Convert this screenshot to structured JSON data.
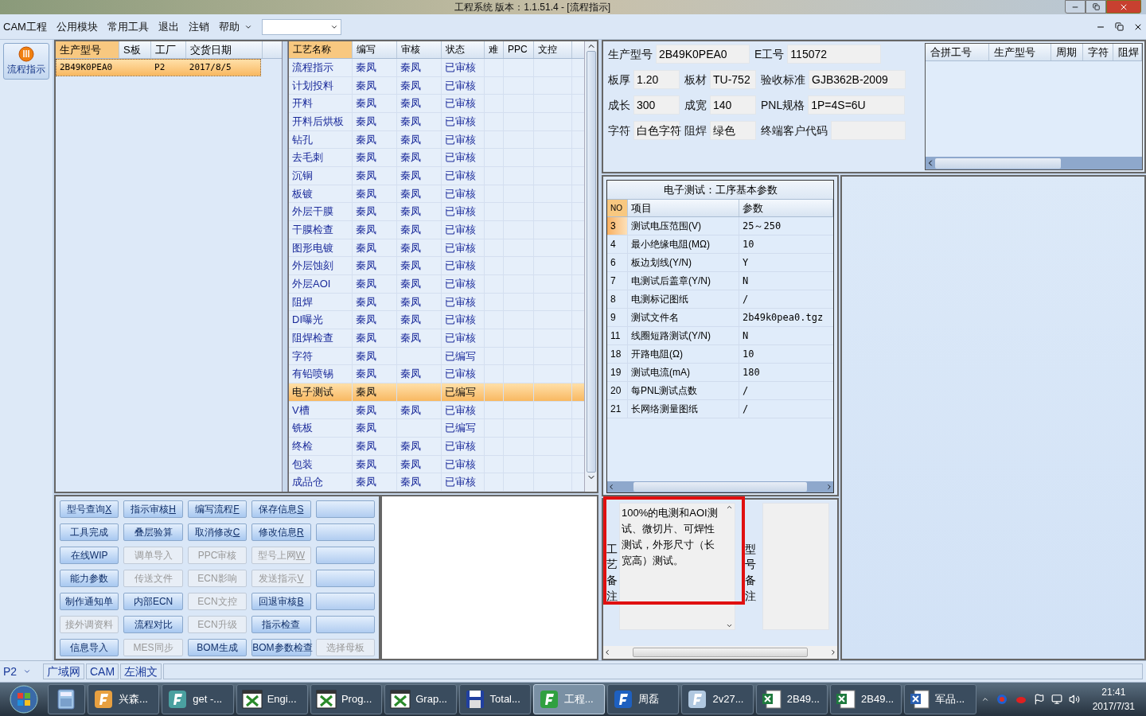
{
  "window": {
    "title": "工程系统   版本：1.1.51.4 - [流程指示]"
  },
  "menu": {
    "items": [
      {
        "label": "CAM工程"
      },
      {
        "label": "公用模块"
      },
      {
        "label": "常用工具"
      },
      {
        "label": "退出"
      },
      {
        "label": "注销"
      },
      {
        "label": "帮助"
      }
    ]
  },
  "side_button": {
    "label": "流程指示"
  },
  "orders": {
    "columns": [
      "生产型号",
      "S板",
      "工厂",
      "交货日期"
    ],
    "rows": [
      {
        "model": "2B49K0PEA0",
        "factory": "P2",
        "date": "2017/8/5",
        "selected": true
      }
    ]
  },
  "process_table": {
    "columns": [
      "工艺名称",
      "编写",
      "审核",
      "状态",
      "难",
      "PPC",
      "文控"
    ],
    "rows": [
      {
        "name": "流程指示",
        "writer": "秦凤",
        "reviewer": "秦凤",
        "status": "已审核",
        "selected": false
      },
      {
        "name": "计划投料",
        "writer": "秦凤",
        "reviewer": "秦凤",
        "status": "已审核",
        "selected": false
      },
      {
        "name": "开料",
        "writer": "秦凤",
        "reviewer": "秦凤",
        "status": "已审核",
        "selected": false
      },
      {
        "name": "开料后烘板",
        "writer": "秦凤",
        "reviewer": "秦凤",
        "status": "已审核",
        "selected": false
      },
      {
        "name": "钻孔",
        "writer": "秦凤",
        "reviewer": "秦凤",
        "status": "已审核",
        "selected": false
      },
      {
        "name": "去毛刺",
        "writer": "秦凤",
        "reviewer": "秦凤",
        "status": "已审核",
        "selected": false
      },
      {
        "name": "沉铜",
        "writer": "秦凤",
        "reviewer": "秦凤",
        "status": "已审核",
        "selected": false
      },
      {
        "name": "板镀",
        "writer": "秦凤",
        "reviewer": "秦凤",
        "status": "已审核",
        "selected": false
      },
      {
        "name": "外层干膜",
        "writer": "秦凤",
        "reviewer": "秦凤",
        "status": "已审核",
        "selected": false
      },
      {
        "name": "干膜检查",
        "writer": "秦凤",
        "reviewer": "秦凤",
        "status": "已审核",
        "selected": false
      },
      {
        "name": "图形电镀",
        "writer": "秦凤",
        "reviewer": "秦凤",
        "status": "已审核",
        "selected": false
      },
      {
        "name": "外层蚀刻",
        "writer": "秦凤",
        "reviewer": "秦凤",
        "status": "已审核",
        "selected": false
      },
      {
        "name": "外层AOI",
        "writer": "秦凤",
        "reviewer": "秦凤",
        "status": "已审核",
        "selected": false
      },
      {
        "name": "阻焊",
        "writer": "秦凤",
        "reviewer": "秦凤",
        "status": "已审核",
        "selected": false
      },
      {
        "name": "DI曝光",
        "writer": "秦凤",
        "reviewer": "秦凤",
        "status": "已审核",
        "selected": false
      },
      {
        "name": "阻焊检查",
        "writer": "秦凤",
        "reviewer": "秦凤",
        "status": "已审核",
        "selected": false
      },
      {
        "name": "字符",
        "writer": "秦凤",
        "status": "已编写",
        "selected": false
      },
      {
        "name": "有铅喷锡",
        "writer": "秦凤",
        "reviewer": "秦凤",
        "status": "已审核",
        "selected": false
      },
      {
        "name": "电子测试",
        "writer": "秦凤",
        "status": "已编写",
        "selected": true
      },
      {
        "name": "V槽",
        "writer": "秦凤",
        "reviewer": "秦凤",
        "status": "已审核",
        "selected": false
      },
      {
        "name": "铣板",
        "writer": "秦凤",
        "status": "已编写",
        "selected": false
      },
      {
        "name": "终检",
        "writer": "秦凤",
        "reviewer": "秦凤",
        "status": "已审核",
        "selected": false
      },
      {
        "name": "包装",
        "writer": "秦凤",
        "reviewer": "秦凤",
        "status": "已审核",
        "selected": false
      },
      {
        "name": "成品仓",
        "writer": "秦凤",
        "reviewer": "秦凤",
        "status": "已审核",
        "selected": false
      }
    ]
  },
  "buttons": [
    {
      "kind": "action",
      "label": "型号查询",
      "key": "X",
      "disabled": false
    },
    {
      "kind": "action",
      "label": "指示审核",
      "key": "H",
      "disabled": false
    },
    {
      "kind": "action",
      "label": "编写流程",
      "key": "F",
      "disabled": false
    },
    {
      "kind": "action",
      "label": "保存信息",
      "key": "S",
      "disabled": false
    },
    {
      "kind": "blank"
    },
    {
      "kind": "action",
      "label": "工具完成",
      "disabled": false
    },
    {
      "kind": "action",
      "label": "叠层验算",
      "disabled": false
    },
    {
      "kind": "action",
      "label": "取消修改",
      "key": "C",
      "disabled": false
    },
    {
      "kind": "action",
      "label": "修改信息",
      "key": "R",
      "disabled": false
    },
    {
      "kind": "blank"
    },
    {
      "kind": "action",
      "label": "在线WIP",
      "disabled": false
    },
    {
      "kind": "action",
      "label": "调单导入",
      "disabled": true
    },
    {
      "kind": "action",
      "label": "PPC审核",
      "disabled": true
    },
    {
      "kind": "action",
      "label": "型号上网",
      "key": "W",
      "disabled": true
    },
    {
      "kind": "blank"
    },
    {
      "kind": "action",
      "label": "能力参数",
      "disabled": false
    },
    {
      "kind": "action",
      "label": "传送文件",
      "disabled": true
    },
    {
      "kind": "action",
      "label": "ECN影响",
      "disabled": true
    },
    {
      "kind": "action",
      "label": "发送指示",
      "key": "V",
      "disabled": true
    },
    {
      "kind": "blank"
    },
    {
      "kind": "action",
      "label": "制作通知单",
      "disabled": false
    },
    {
      "kind": "action",
      "label": "内部ECN",
      "disabled": false
    },
    {
      "kind": "action",
      "label": "ECN文控",
      "disabled": true
    },
    {
      "kind": "action",
      "label": "回退审核",
      "key": "B",
      "disabled": false
    },
    {
      "kind": "blank"
    },
    {
      "kind": "action",
      "label": "接外调资料",
      "disabled": true
    },
    {
      "kind": "action",
      "label": "流程对比",
      "disabled": false
    },
    {
      "kind": "action",
      "label": "ECN升级",
      "disabled": true
    },
    {
      "kind": "action",
      "label": "指示检查",
      "disabled": false
    },
    {
      "kind": "blank"
    },
    {
      "kind": "action",
      "label": "信息导入",
      "disabled": false
    },
    {
      "kind": "action",
      "label": "MES同步",
      "disabled": true
    },
    {
      "kind": "action",
      "label": "BOM生成",
      "disabled": false
    },
    {
      "kind": "action",
      "label": "BOM参数检查",
      "disabled": false
    },
    {
      "kind": "action",
      "label": "选择母板",
      "disabled": true
    }
  ],
  "info_form": {
    "fields": [
      {
        "label": "生产型号",
        "value": "2B49K0PEA0"
      },
      {
        "label": "E工号",
        "value": "115072"
      },
      {
        "label": "板厚",
        "value": "1.20"
      },
      {
        "label": "板材",
        "value": "TU-752"
      },
      {
        "label": "验收标准",
        "value": "GJB362B-2009"
      },
      {
        "label": "成长",
        "value": "300"
      },
      {
        "label": "成宽",
        "value": "140"
      },
      {
        "label": "PNL规格",
        "value": "1P=4S=6U"
      },
      {
        "label": "字符",
        "value": "白色字符"
      },
      {
        "label": "阻焊",
        "value": "绿色"
      },
      {
        "label": "终端客户代码"
      }
    ]
  },
  "merge_table": {
    "columns": [
      "合拼工号",
      "生产型号",
      "周期",
      "字符",
      "阻焊"
    ]
  },
  "params": {
    "title": "电子测试：工序基本参数",
    "columns": [
      "NO",
      "项目",
      "参数"
    ],
    "rows": [
      {
        "no": "3",
        "item": "测试电压范围(V)",
        "value": "25～250",
        "selected": true
      },
      {
        "no": "4",
        "item": "最小绝缘电阻(MΩ)",
        "value": "10",
        "selected": false
      },
      {
        "no": "6",
        "item": "板边划线(Y/N)",
        "value": "Y",
        "selected": false
      },
      {
        "no": "7",
        "item": "电测试后盖章(Y/N)",
        "value": "N",
        "selected": false
      },
      {
        "no": "8",
        "item": "电测标记图纸",
        "value": "/",
        "selected": false
      },
      {
        "no": "9",
        "item": "测试文件名",
        "value": "2b49k0pea0.tgz",
        "selected": false
      },
      {
        "no": "11",
        "item": "线圈短路测试(Y/N)",
        "value": "N",
        "selected": false
      },
      {
        "no": "18",
        "item": "开路电阻(Ω)",
        "value": "10",
        "selected": false
      },
      {
        "no": "19",
        "item": "测试电流(mA)",
        "value": "180",
        "selected": false
      },
      {
        "no": "20",
        "item": "每PNL测试点数",
        "value": "/",
        "selected": false
      },
      {
        "no": "21",
        "item": "长网络测量图纸",
        "value": "/",
        "selected": false
      }
    ]
  },
  "notes": {
    "process_label": "工艺备注",
    "process_note": "100%的电测和AOI测试、微切片、可焊性测试，外形尺寸（长宽高）测试。",
    "model_label": "型号备注",
    "highlighted": true
  },
  "status_bar": {
    "factory": "P2",
    "items": [
      "广域网",
      "CAM",
      "左湘文"
    ]
  },
  "taskbar": {
    "items": [
      {
        "kind": "calculator",
        "selected": false
      },
      {
        "kind": "app",
        "label": "兴森...",
        "selected": false
      },
      {
        "kind": "app",
        "label": "get -...",
        "selected": false
      },
      {
        "kind": "window",
        "label": "Engi...",
        "selected": false
      },
      {
        "kind": "window",
        "label": "Prog...",
        "selected": false
      },
      {
        "kind": "window",
        "label": "Grap...",
        "selected": false
      },
      {
        "kind": "floppy",
        "label": "Total...",
        "selected": false
      },
      {
        "kind": "app",
        "label": "工程...",
        "selected": true
      },
      {
        "kind": "app",
        "label": "周磊",
        "selected": false
      },
      {
        "kind": "app",
        "label": "2v27...",
        "selected": false
      },
      {
        "kind": "document",
        "label": "2B49...",
        "selected": false
      },
      {
        "kind": "document",
        "label": "2B49...",
        "selected": false
      },
      {
        "kind": "document",
        "label": "军品...",
        "selected": false
      }
    ],
    "time": "21:41",
    "date": "2017/7/31"
  }
}
